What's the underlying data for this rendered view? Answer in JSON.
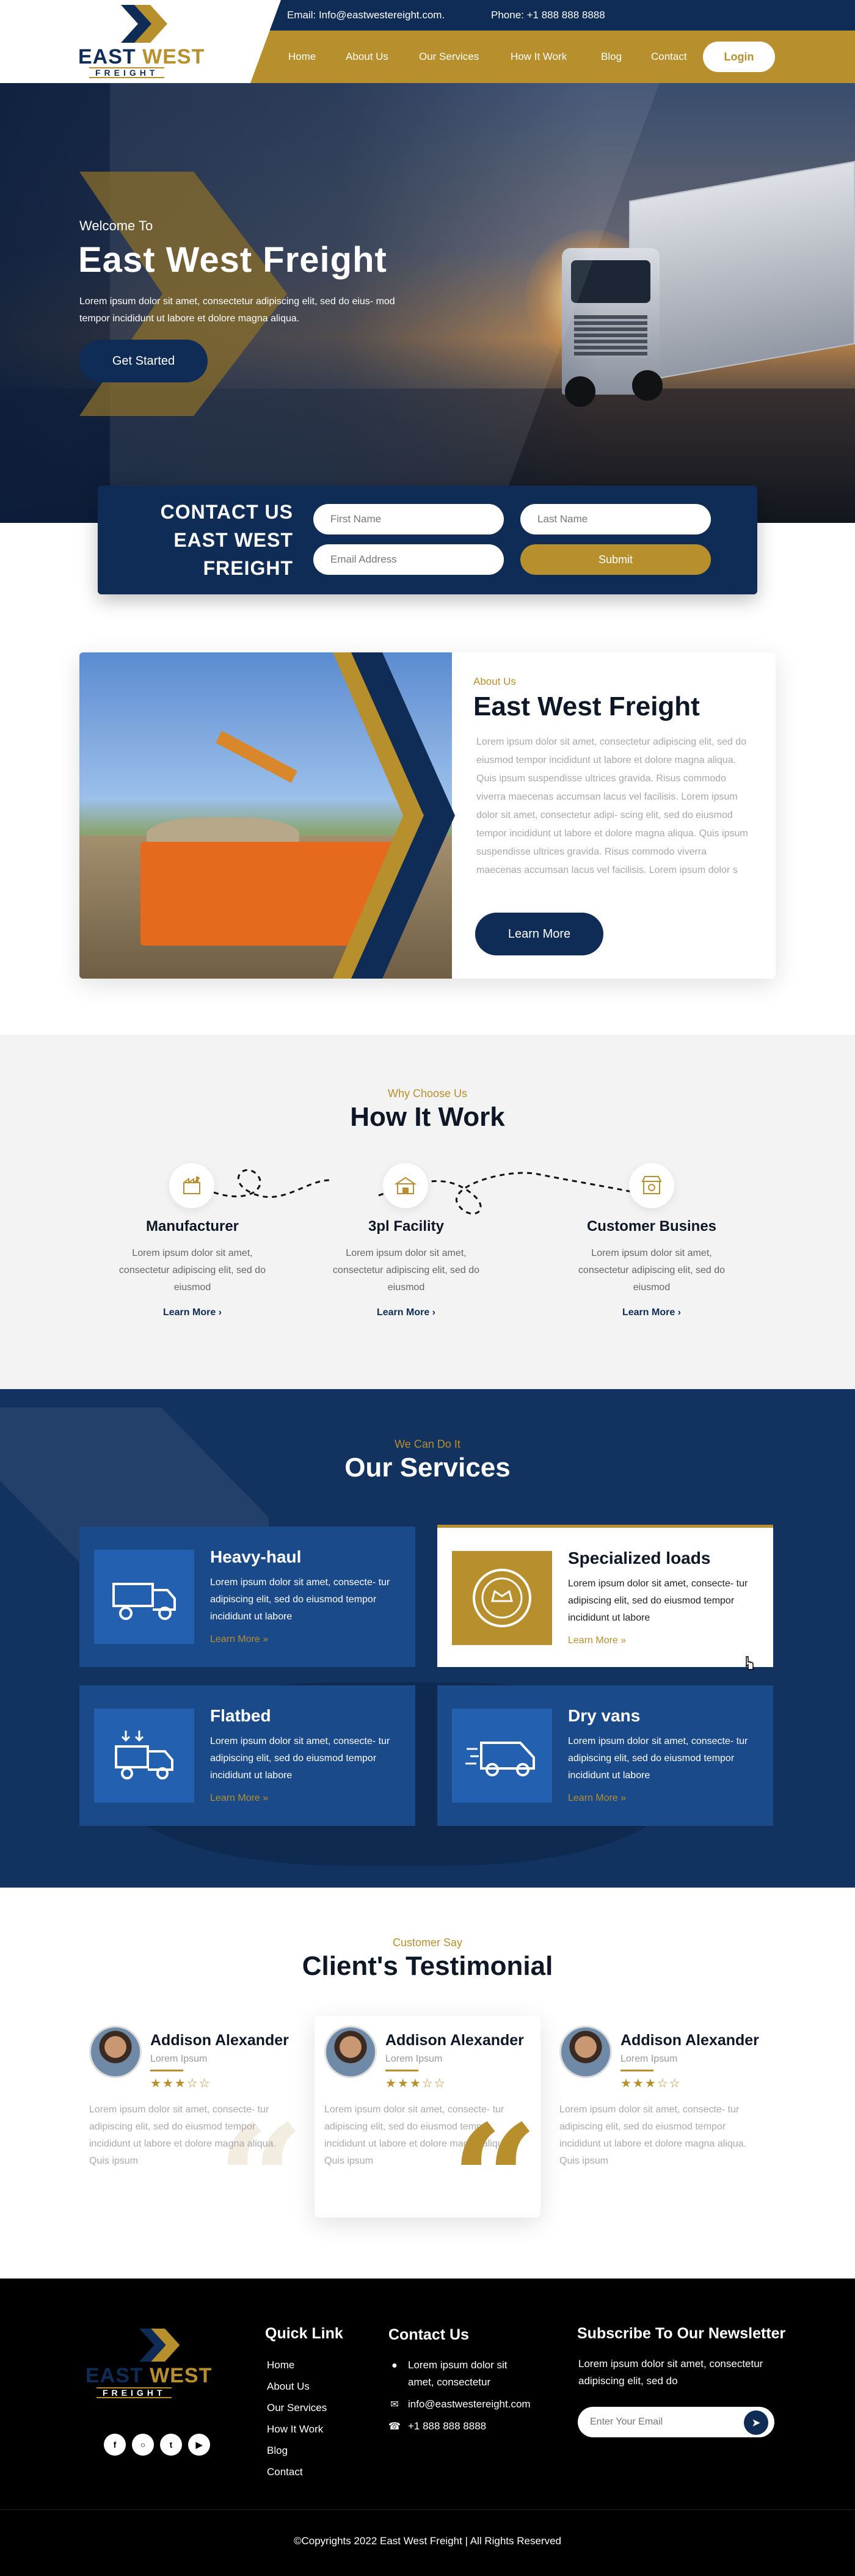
{
  "header": {
    "email": "Email: Info@eastwestereight.com.",
    "phone": "Phone: +1 888 888 8888",
    "logo_line1_a": "EAST ",
    "logo_line1_b": "WEST",
    "logo_line2": "FREIGHT",
    "nav": [
      "Home",
      "About Us",
      "Our Services",
      "How It Work",
      "Blog",
      "Contact"
    ],
    "login_label": "Login"
  },
  "hero": {
    "kicker": "Welcome To",
    "title": "East West Freight",
    "description": "Lorem ipsum dolor sit amet, consectetur adipiscing elit, sed do eius- mod tempor incididunt ut labore et dolore magna aliqua.",
    "button_label": "Get Started"
  },
  "contact_form": {
    "title_line1": "CONTACT US",
    "title_line2": "EAST WEST",
    "title_line3": "FREIGHT",
    "first_name_placeholder": "First Name",
    "last_name_placeholder": "Last Name",
    "email_placeholder": "Email Address",
    "submit_label": "Submit"
  },
  "about": {
    "kicker": "About Us",
    "title": "East West Freight",
    "description": "Lorem ipsum dolor sit amet, consectetur adipiscing elit, sed do eiusmod tempor incididunt ut labore et dolore magna aliqua. Quis ipsum suspendisse ultrices gravida. Risus commodo viverra maecenas accumsan lacus vel facilisis. Lorem ipsum dolor sit amet, consectetur adipi- scing elit, sed do eiusmod tempor incididunt ut labore et dolore magna aliqua. Quis ipsum suspendisse ultrices gravida. Risus commodo viverra maecenas accumsan lacus vel facilisis. Lorem ipsum dolor s",
    "button_label": "Learn More"
  },
  "how": {
    "kicker": "Why Choose Us",
    "title": "How It Work",
    "steps": [
      {
        "title": "Manufacturer",
        "text": "Lorem ipsum dolor sit amet, consectetur adipiscing elit, sed do eiusmod",
        "link": "Learn More ›",
        "icon": "factory-icon"
      },
      {
        "title": "3pl Facility",
        "text": "Lorem ipsum dolor sit amet, consectetur adipiscing elit, sed do eiusmod",
        "link": "Learn More ›",
        "icon": "warehouse-icon"
      },
      {
        "title": "Customer Busines",
        "text": "Lorem ipsum dolor sit amet, consectetur adipiscing elit, sed do eiusmod",
        "link": "Learn More ›",
        "icon": "store-icon"
      }
    ]
  },
  "services": {
    "kicker": "We Can Do It",
    "title": "Our Services",
    "items": [
      {
        "title": "Heavy-haul",
        "text": "Lorem ipsum dolor sit amet, consecte- tur adipiscing elit, sed do eiusmod tempor incididunt ut labore",
        "link": "Learn More »",
        "icon": "dump-truck-icon"
      },
      {
        "title": "Specialized loads",
        "text": "Lorem ipsum dolor sit amet, consecte- tur adipiscing elit, sed do eiusmod tempor incididunt ut labore",
        "link": "Learn More »",
        "icon": "badge-icon"
      },
      {
        "title": "Flatbed",
        "text": "Lorem ipsum dolor sit amet, consecte- tur adipiscing elit, sed do eiusmod tempor incididunt ut labore",
        "link": "Learn More »",
        "icon": "flatbed-truck-icon"
      },
      {
        "title": "Dry vans",
        "text": "Lorem ipsum dolor sit amet, consecte- tur adipiscing elit, sed do eiusmod tempor incididunt ut labore",
        "link": "Learn More »",
        "icon": "delivery-van-icon"
      }
    ]
  },
  "testimonials": {
    "kicker": "Customer Say",
    "title": "Client's Testimonial",
    "items": [
      {
        "name": "Addison Alexander",
        "role": "Lorem Ipsum",
        "stars": "★★★☆☆",
        "rating": 3,
        "text": "Lorem ipsum dolor sit amet, consecte- tur adipiscing elit, sed do eiusmod tempor incididunt ut labore et dolore magna aliqua. Quis ipsum"
      },
      {
        "name": "Addison Alexander",
        "role": "Lorem Ipsum",
        "stars": "★★★☆☆",
        "rating": 3,
        "text": "Lorem ipsum dolor sit amet, consecte- tur adipiscing elit, sed do eiusmod tempor incididunt ut labore et dolore magna aliqua. Quis ipsum"
      },
      {
        "name": "Addison Alexander",
        "role": "Lorem Ipsum",
        "stars": "★★★☆☆",
        "rating": 3,
        "text": "Lorem ipsum dolor sit amet, consecte- tur adipiscing elit, sed do eiusmod tempor incididunt ut labore et dolore magna aliqua. Quis ipsum"
      }
    ]
  },
  "footer": {
    "quick_link_title": "Quick Link",
    "quick_links": [
      "Home",
      "About Us",
      "Our Services",
      "How It Work",
      "Blog",
      "Contact"
    ],
    "contact_title": "Contact Us",
    "address": "Lorem ipsum dolor sit amet, consectetur",
    "email": "info@eastwestereight.com",
    "phone": "+1 888 888 8888",
    "newsletter_title": "Subscribe To Our Newsletter",
    "newsletter_text": "Lorem ipsum dolor sit amet, consectetur adipiscing elit, sed do",
    "newsletter_placeholder": "Enter Your Email",
    "social": [
      "facebook-icon",
      "instagram-icon",
      "twitter-icon",
      "youtube-icon"
    ],
    "copyright": "©Copyrights 2022  East West Freight   |   All Rights Reserved"
  },
  "colors": {
    "navy": "#0e2c55",
    "gold": "#b78f2d",
    "service_bg": "#12325f",
    "card_blue": "#1a4a8a"
  }
}
